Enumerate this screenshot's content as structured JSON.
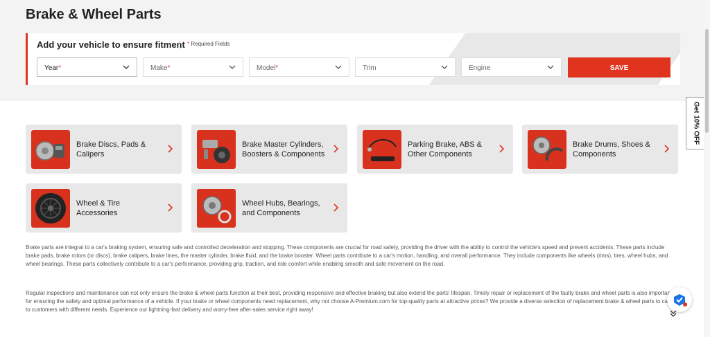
{
  "page": {
    "title": "Brake & Wheel Parts"
  },
  "fitment": {
    "heading": "Add your vehicle to ensure fitment",
    "required_star": "*",
    "required_note": "Required Fields",
    "selects": [
      {
        "label": "Year",
        "required": "*"
      },
      {
        "label": "Make",
        "required": "*"
      },
      {
        "label": "Model",
        "required": "*"
      },
      {
        "label": "Trim",
        "required": ""
      },
      {
        "label": "Engine",
        "required": ""
      }
    ],
    "save_label": "SAVE"
  },
  "side_tab": {
    "label": "Get 10% OFF"
  },
  "categories": [
    {
      "name": "Brake Discs, Pads & Calipers",
      "icon": "brake-discs-image"
    },
    {
      "name": "Brake Master Cylinders, Boosters & Components",
      "icon": "master-cylinder-image"
    },
    {
      "name": "Parking Brake, ABS & Other Components",
      "icon": "parking-brake-cable-image"
    },
    {
      "name": "Brake Drums, Shoes & Components",
      "icon": "brake-drum-image"
    },
    {
      "name": "Wheel & Tire Accessories",
      "icon": "wheel-image"
    },
    {
      "name": "Wheel Hubs, Bearings, and Components",
      "icon": "wheel-hub-image"
    }
  ],
  "description": {
    "paragraph1": "Brake parts are integral to a car's braking system, ensuring safe and controlled deceleration and stopping. These components are crucial for road safety, providing the driver with the ability to control the vehicle's speed and prevent accidents. These parts include brake pads, brake rotors (or discs), brake calipers, brake lines, the master cylinder, brake fluid, and the brake booster. Wheel parts contribute to a car's motion, handling, and overall performance. They include components like wheels (rims), tires, wheel hubs, and wheel bearings. These parts collectively contribute to a car's performance, providing grip, traction, and ride comfort while enabling smooth and safe movement on the road.",
    "paragraph2": "Regular inspections and maintenance can not only ensure the brake & wheel parts function at their best, providing responsive and effective braking but also extend the parts' lifespan. Timely repair or replacement of the faulty brake and wheel parts is also important for ensuring the safety and optimal performance of a vehicle. If your brake or wheel components need replacement, why not choose A-Premium.com for top-quality parts at attractive prices? We provide a diverse selection of replacement brake & wheel parts to cater to customers with different needs. Experience our lightning-fast delivery and worry-free after-sales service right away!"
  },
  "colors": {
    "accent": "#e0341f",
    "card_bg": "#e8e8e8",
    "hero_bg": "#f3f3f3"
  }
}
